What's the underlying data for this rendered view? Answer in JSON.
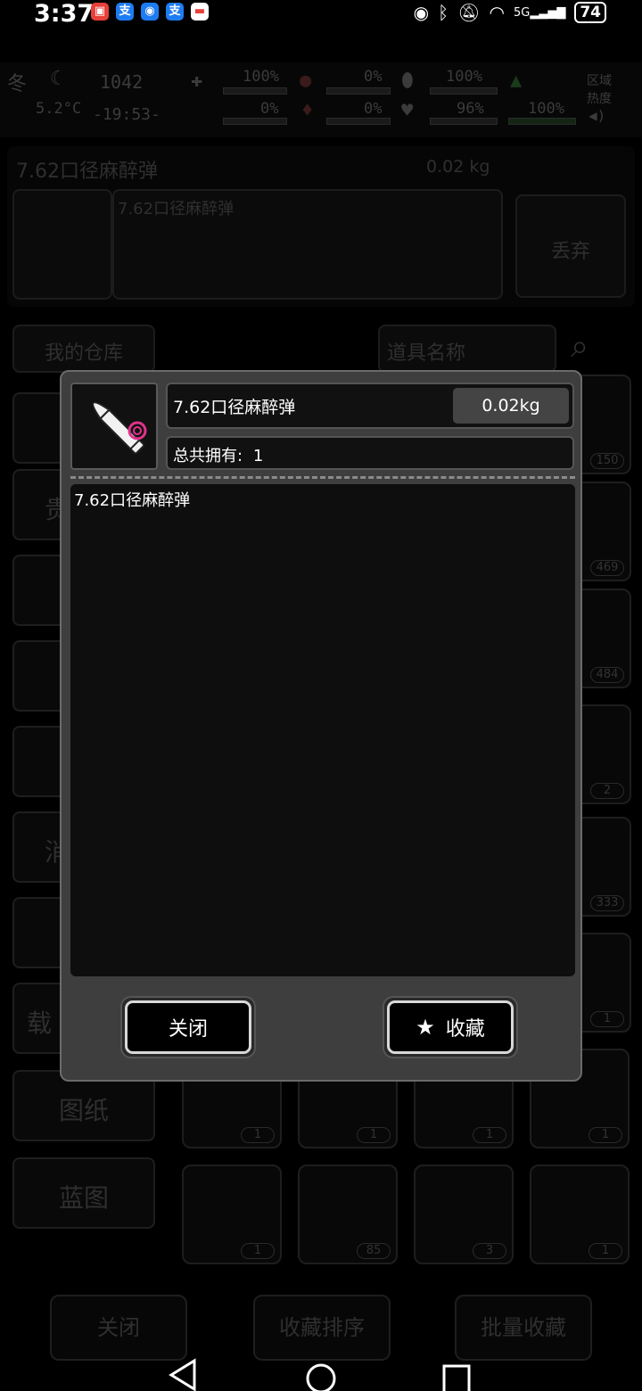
{
  "status_bar": {
    "time": "3:37",
    "battery": "74",
    "network": "5G"
  },
  "hud": {
    "season": "冬",
    "temperature": "5.2°C",
    "clock_top": "1042",
    "clock_bottom": "-19:53-",
    "health_pct": "100%",
    "health_sub": "0%",
    "hunger_pct": "0%",
    "thirst_pct": "0%",
    "pill_pct": "100%",
    "heart_pct": "96%",
    "fuel_pct": "100%",
    "area_label": "区域",
    "heat_label": "热度"
  },
  "background": {
    "item_title": "7.62口径麻醉弹",
    "item_weight": "0.02 kg",
    "item_desc": "7.62口径麻醉弹",
    "discard_label": "丢弃",
    "warehouse_tab": "我的仓库",
    "search_placeholder": "道具名称",
    "side_tabs": [
      "贵",
      "消",
      "载",
      "图纸",
      "蓝图"
    ],
    "item_counts": [
      "150",
      "469",
      "484",
      "2",
      "333",
      "1",
      "1",
      "1",
      "1",
      "1",
      "1",
      "85",
      "3",
      "1"
    ],
    "bottom_close": "关闭",
    "bottom_sort": "收藏排序",
    "bottom_batch": "批量收藏"
  },
  "modal": {
    "item_name": "7.62口径麻醉弹",
    "weight": "0.02kg",
    "owned_label": "总共拥有:",
    "owned_count": "1",
    "description": "7.62口径麻醉弹",
    "close_label": "关闭",
    "favorite_label": "收藏",
    "accent_color": "#e0338c"
  }
}
